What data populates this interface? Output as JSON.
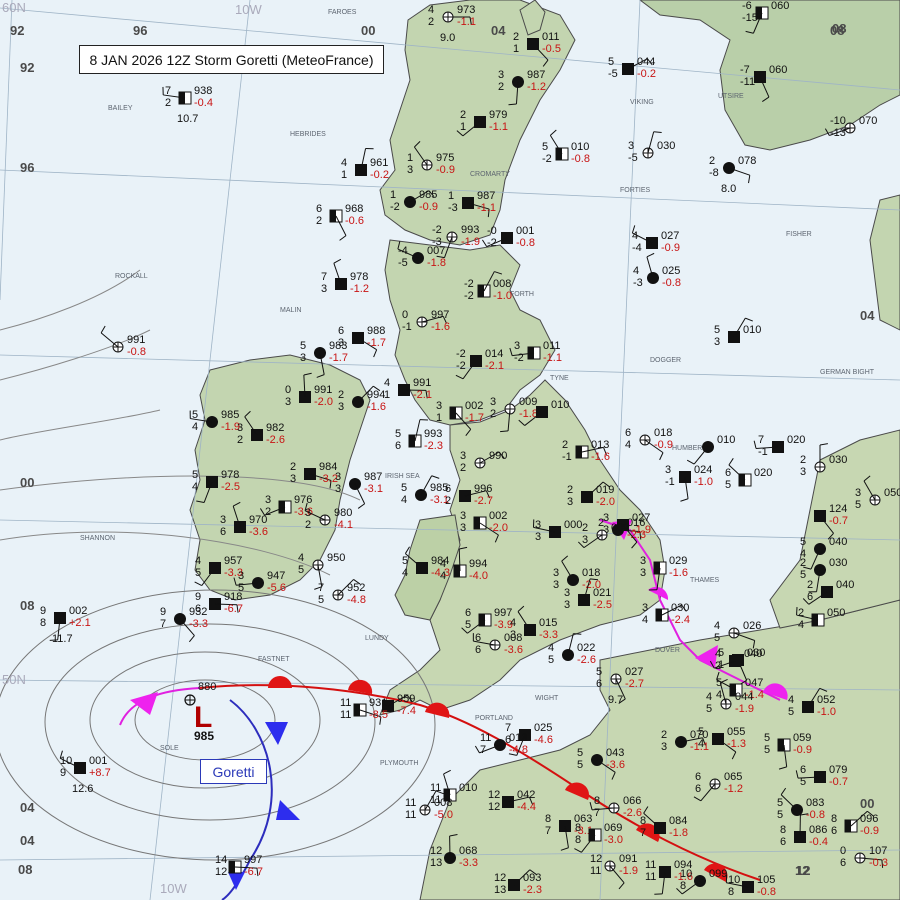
{
  "title": "8 JAN 2026 12Z Storm Goretti (MeteoFrance)",
  "low": {
    "symbol": "L",
    "pressure": "985",
    "name": "Goretti",
    "point_value": "880"
  },
  "grid_labels": {
    "top": [
      "92",
      "96",
      "00",
      "04",
      "08",
      "12"
    ],
    "left": [
      "92",
      "96",
      "00",
      "04",
      "08"
    ],
    "right": [
      "08",
      "04",
      "00",
      "04",
      "08",
      "12"
    ],
    "lat_lon": [
      "60N",
      "10W",
      "50N",
      "10W"
    ]
  },
  "sea_areas": [
    "FAROES",
    "BAILEY",
    "HEBRIDES",
    "ROCKALL",
    "MALIN",
    "SHANNON",
    "FASTNET",
    "SOLE",
    "LUNDY",
    "IRISH SEA",
    "PLYMOUTH",
    "PORTLAND",
    "WIGHT",
    "DOVER",
    "THAMES",
    "HUMBER",
    "TYNE",
    "FORTH",
    "CROMARTY",
    "FORTIES",
    "VIKING",
    "FISHER",
    "DOGGER",
    "GERMAN BIGHT",
    "UTSIRE"
  ],
  "stations": [
    {
      "p": "973",
      "d": "-1.1",
      "s": [
        "4",
        "2"
      ],
      "e": "9.0"
    },
    {
      "p": "011",
      "d": "-0.5",
      "s": [
        "2",
        "1"
      ]
    },
    {
      "p": "987",
      "d": "-1.2",
      "s": [
        "3",
        "2"
      ]
    },
    {
      "p": "979",
      "d": "-1.1",
      "s": [
        "2",
        "1"
      ]
    },
    {
      "p": "938",
      "d": "-0.4",
      "s": [
        "7",
        "2"
      ],
      "e": "10.7"
    },
    {
      "p": "975",
      "d": "-0.9",
      "s": [
        "1",
        "3"
      ]
    },
    {
      "p": "961",
      "d": "-0.2",
      "s": [
        "4",
        "1"
      ]
    },
    {
      "p": "985",
      "d": "-0.9",
      "s": [
        "1",
        "-2"
      ]
    },
    {
      "p": "987",
      "d": "-1.1",
      "s": [
        "1",
        "-3"
      ]
    },
    {
      "p": "968",
      "d": "-0.6",
      "s": [
        "6",
        "2"
      ]
    },
    {
      "p": "993",
      "d": "-1.9",
      "s": [
        "-2",
        "-3"
      ]
    },
    {
      "p": "001",
      "d": "-0.8",
      "s": [
        "-0",
        "-2"
      ]
    },
    {
      "p": "007",
      "d": "-1.8",
      "s": [
        "-4",
        "-5"
      ]
    },
    {
      "p": "978",
      "d": "-1.2",
      "s": [
        "7",
        "3"
      ]
    },
    {
      "p": "008",
      "d": "-1.0",
      "s": [
        "-2",
        "-2"
      ]
    },
    {
      "p": "997",
      "d": "-1.6",
      "s": [
        "0",
        "-1"
      ]
    },
    {
      "p": "988",
      "d": "-1.7",
      "s": [
        "6",
        "3"
      ]
    },
    {
      "p": "983",
      "d": "-1.7",
      "s": [
        "5",
        "3"
      ]
    },
    {
      "p": "014",
      "d": "-2.1",
      "s": [
        "-2",
        "-2"
      ]
    },
    {
      "p": "011",
      "d": "-1.1",
      "s": [
        "3",
        "-2"
      ]
    },
    {
      "p": "991",
      "d": "-0.8",
      "s": []
    },
    {
      "p": "991",
      "d": "-2.0",
      "s": [
        "0",
        "3"
      ]
    },
    {
      "p": "994",
      "d": "-1.6",
      "s": [
        "2",
        "3"
      ]
    },
    {
      "p": "991",
      "d": "-2.1",
      "s": [
        "4",
        "1"
      ]
    },
    {
      "p": "002",
      "d": "-1.7",
      "s": [
        "3",
        "1"
      ]
    },
    {
      "p": "009",
      "d": "-1.8",
      "s": [
        "3",
        "2"
      ]
    },
    {
      "p": "010",
      "d": "",
      "s": []
    },
    {
      "p": "985",
      "d": "-1.9",
      "s": [
        "5",
        "4"
      ]
    },
    {
      "p": "982",
      "d": "-2.6",
      "s": [
        "3",
        "2"
      ]
    },
    {
      "p": "993",
      "d": "-2.3",
      "s": [
        "5",
        "6"
      ]
    },
    {
      "p": "990",
      "d": "",
      "s": [
        "3",
        "2"
      ]
    },
    {
      "p": "984",
      "d": "-3.2",
      "s": [
        "2",
        "3"
      ]
    },
    {
      "p": "987",
      "d": "-3.1",
      "s": [
        "3",
        "3"
      ]
    },
    {
      "p": "978",
      "d": "-2.5",
      "s": [
        "5",
        "4"
      ]
    },
    {
      "p": "976",
      "d": "-3.6",
      "s": [
        "3",
        "2"
      ]
    },
    {
      "p": "980",
      "d": "-4.1",
      "s": [
        "3",
        "2"
      ]
    },
    {
      "p": "970",
      "d": "-3.6",
      "s": [
        "3",
        "6"
      ]
    },
    {
      "p": "985",
      "d": "-3.1",
      "s": [
        "5",
        "4"
      ]
    },
    {
      "p": "996",
      "d": "-2.7",
      "s": [
        "6",
        "2"
      ]
    },
    {
      "p": "002",
      "d": "-2.0",
      "s": [
        "3",
        "3"
      ]
    },
    {
      "p": "950",
      "d": "",
      "s": [
        "4",
        "5"
      ]
    },
    {
      "p": "957",
      "d": "-3.3",
      "s": [
        "4",
        "5"
      ]
    },
    {
      "p": "947",
      "d": "-5.6",
      "s": [
        "3",
        "5"
      ]
    },
    {
      "p": "984",
      "d": "-4.3",
      "s": [
        "5",
        "4"
      ]
    },
    {
      "p": "994",
      "d": "-4.0",
      "s": [
        "4",
        "4"
      ]
    },
    {
      "p": "952",
      "d": "-4.8",
      "s": [
        "7",
        "5"
      ]
    },
    {
      "p": "918",
      "d": "-6.7",
      "s": [
        "9",
        "6"
      ]
    },
    {
      "p": "932",
      "d": "-3.3",
      "s": [
        "9",
        "7"
      ]
    },
    {
      "p": "002",
      "d": "+2.1",
      "s": [
        "9",
        "8"
      ],
      "e": "11.7"
    },
    {
      "p": "997",
      "d": "-3.9",
      "s": [
        "6",
        "5"
      ]
    },
    {
      "p": "008",
      "d": "-3.6",
      "s": [
        "6",
        "6"
      ]
    },
    {
      "p": "015",
      "d": "-3.3",
      "s": [
        "4",
        "3"
      ]
    },
    {
      "p": "022",
      "d": "-2.6",
      "s": [
        "4",
        "5"
      ]
    },
    {
      "p": "959",
      "d": "-7.4",
      "s": []
    },
    {
      "p": "931",
      "d": "-8.5",
      "s": [
        "11",
        "11"
      ]
    },
    {
      "p": "027",
      "d": "-2.7",
      "s": [
        "5",
        "6"
      ],
      "e": "9.7"
    },
    {
      "p": "025",
      "d": "-4.6",
      "s": [
        "7",
        "6"
      ]
    },
    {
      "p": "013",
      "d": "-4.8",
      "s": [
        "11",
        "7"
      ]
    },
    {
      "p": "001",
      "d": "+8.7",
      "s": [
        "10",
        "9"
      ],
      "e": "12.6"
    },
    {
      "p": "010",
      "d": "",
      "s": [
        "11",
        "11"
      ]
    },
    {
      "p": "008",
      "d": "-5.0",
      "s": [
        "11",
        "11"
      ]
    },
    {
      "p": "042",
      "d": "-4.4",
      "s": [
        "12",
        "12"
      ]
    },
    {
      "p": "043",
      "d": "-3.6",
      "s": [
        "5",
        "5"
      ]
    },
    {
      "p": "063",
      "d": "-3.1",
      "s": [
        "8",
        "7"
      ]
    },
    {
      "p": "069",
      "d": "-3.0",
      "s": [
        "8",
        "8"
      ]
    },
    {
      "p": "066",
      "d": "-2.6",
      "s": [
        "8",
        "7"
      ]
    },
    {
      "p": "084",
      "d": "-1.8",
      "s": [
        "8",
        "7"
      ]
    },
    {
      "p": "068",
      "d": "-3.3",
      "s": [
        "12",
        "13"
      ]
    },
    {
      "p": "093",
      "d": "-2.3",
      "s": [
        "12",
        "13"
      ]
    },
    {
      "p": "997",
      "d": "-6.7",
      "s": [
        "14",
        "12"
      ]
    },
    {
      "p": "091",
      "d": "-1.9",
      "s": [
        "12",
        "11"
      ]
    },
    {
      "p": "094",
      "d": "-1.6",
      "s": [
        "11",
        "11"
      ]
    },
    {
      "p": "099",
      "d": "",
      "s": [
        "10",
        "8"
      ]
    },
    {
      "p": "105",
      "d": "-0.8",
      "s": [
        "10",
        "8"
      ]
    },
    {
      "p": "010",
      "d": "-0.8",
      "s": [
        "5",
        "-2"
      ]
    },
    {
      "p": "030",
      "d": "",
      "s": [
        "3",
        "-5"
      ]
    },
    {
      "p": "044",
      "d": "-0.2",
      "s": [
        "5",
        "-5"
      ]
    },
    {
      "p": "078",
      "d": "",
      "s": [
        "2",
        "-8"
      ],
      "e": "8.0"
    },
    {
      "p": "060",
      "d": "",
      "s": [
        "-7",
        "-11"
      ]
    },
    {
      "p": "060",
      "d": "",
      "s": [
        "-6",
        "-15"
      ]
    },
    {
      "p": "070",
      "d": "",
      "s": [
        "-10",
        "-13"
      ]
    },
    {
      "p": "027",
      "d": "-0.9",
      "s": [
        "4",
        "-4"
      ]
    },
    {
      "p": "025",
      "d": "-0.8",
      "s": [
        "4",
        "-3"
      ]
    },
    {
      "p": "010",
      "d": "",
      "s": [
        "5",
        "3"
      ]
    },
    {
      "p": "013",
      "d": "-1.6",
      "s": [
        "2",
        "-1"
      ]
    },
    {
      "p": "018",
      "d": "-0.9",
      "s": [
        "6",
        "4"
      ]
    },
    {
      "p": "024",
      "d": "-1.0",
      "s": [
        "3",
        "-1"
      ]
    },
    {
      "p": "010",
      "d": "",
      "s": []
    },
    {
      "p": "020",
      "d": "",
      "s": [
        "7",
        "-1"
      ]
    },
    {
      "p": "020",
      "d": "",
      "s": [
        "6",
        "5"
      ]
    },
    {
      "p": "030",
      "d": "",
      "s": [
        "2",
        "3"
      ]
    },
    {
      "p": "019",
      "d": "-2.0",
      "s": [
        "2",
        "3"
      ]
    },
    {
      "p": "016",
      "d": "-2.3",
      "s": [
        "2",
        "3"
      ]
    },
    {
      "p": "027",
      "d": "-1.9",
      "s": [
        "3",
        "3"
      ]
    },
    {
      "p": "029",
      "d": "-1.6",
      "s": [
        "3",
        "3"
      ]
    },
    {
      "p": "000",
      "d": "",
      "s": [
        "2",
        "3"
      ]
    },
    {
      "p": "000",
      "d": "",
      "s": [
        "3",
        "3"
      ]
    },
    {
      "p": "018",
      "d": "-2.0",
      "s": [
        "3",
        "3"
      ]
    },
    {
      "p": "021",
      "d": "-2.5",
      "s": [
        "3",
        "3"
      ]
    },
    {
      "p": "030",
      "d": "-2.4",
      "s": [
        "3",
        "4"
      ]
    },
    {
      "p": "026",
      "d": "",
      "s": [
        "4",
        "5"
      ]
    },
    {
      "p": "030",
      "d": "",
      "s": [
        "5",
        "1"
      ]
    },
    {
      "p": "040",
      "d": "",
      "s": [
        "5",
        "4"
      ]
    },
    {
      "p": "040",
      "d": "",
      "s": [
        "4",
        "2"
      ]
    },
    {
      "p": "047",
      "d": "-1.4",
      "s": [
        "5",
        "4"
      ]
    },
    {
      "p": "044",
      "d": "-1.9",
      "s": [
        "4",
        "5"
      ]
    },
    {
      "p": "052",
      "d": "-1.0",
      "s": [
        "4",
        "5"
      ]
    },
    {
      "p": "070",
      "d": "-1.1",
      "s": [
        "2",
        "3"
      ]
    },
    {
      "p": "055",
      "d": "-1.3",
      "s": [
        "5",
        "4"
      ]
    },
    {
      "p": "059",
      "d": "-0.9",
      "s": [
        "5",
        "5"
      ]
    },
    {
      "p": "065",
      "d": "-1.2",
      "s": [
        "6",
        "6"
      ]
    },
    {
      "p": "079",
      "d": "-0.7",
      "s": [
        "6",
        "5"
      ]
    },
    {
      "p": "083",
      "d": "-0.8",
      "s": [
        "5",
        "5"
      ]
    },
    {
      "p": "086",
      "d": "-0.4",
      "s": [
        "8",
        "6"
      ]
    },
    {
      "p": "096",
      "d": "-0.9",
      "s": [
        "8",
        "6"
      ]
    },
    {
      "p": "107",
      "d": "-0.3",
      "s": [
        "0",
        "6"
      ]
    },
    {
      "p": "124",
      "d": "-0.7",
      "s": []
    },
    {
      "p": "030",
      "d": "",
      "s": [
        "2",
        "5"
      ]
    },
    {
      "p": "040",
      "d": "",
      "s": [
        "2",
        "6"
      ]
    },
    {
      "p": "050",
      "d": "",
      "s": [
        "2",
        "4"
      ]
    },
    {
      "p": "050",
      "d": "",
      "s": [
        "3",
        "5"
      ]
    },
    {
      "p": "040",
      "d": "",
      "s": [
        "2",
        "6"
      ]
    }
  ]
}
